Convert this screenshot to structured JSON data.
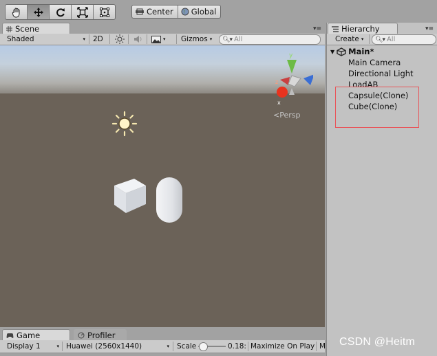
{
  "toolbar": {
    "tools": [
      {
        "icon": "hand-icon",
        "active": false
      },
      {
        "icon": "move-icon",
        "active": true
      },
      {
        "icon": "rotate-icon",
        "active": false
      },
      {
        "icon": "scale-icon",
        "active": false
      },
      {
        "icon": "rect-tool-icon",
        "active": false
      }
    ],
    "pivot_label": "Center",
    "space_label": "Global"
  },
  "scene": {
    "tab_label": "Scene",
    "shading_mode": "Shaded",
    "mode_2d_label": "2D",
    "gizmos_label": "Gizmos",
    "search_placeholder": "All",
    "persp_label": "Persp",
    "gizmo_axes": {
      "y": "y",
      "x": "x",
      "z": "z"
    }
  },
  "game": {
    "tab_label": "Game",
    "profiler_tab_label": "Profiler",
    "display_label": "Display 1",
    "resolution_label": "Huawei (2560x1440)",
    "scale_label": "Scale",
    "scale_value": "0.18:",
    "maximize_label": "Maximize On Play",
    "truncated_label": "M"
  },
  "hierarchy": {
    "tab_label": "Hierarchy",
    "create_label": "Create",
    "search_placeholder": "All",
    "scene_name": "Main*",
    "items": [
      "Main Camera",
      "Directional Light",
      "LoadAB",
      "Capsule(Clone)",
      "Cube(Clone)"
    ],
    "highlight_color": "#e8555a"
  },
  "watermark": "CSDN @Heitm"
}
